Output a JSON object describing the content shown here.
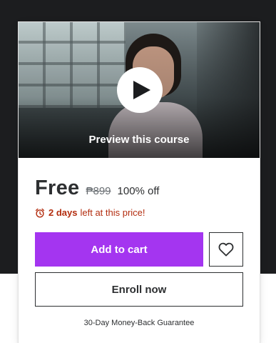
{
  "preview": {
    "label": "Preview this course",
    "play_icon": "play-icon"
  },
  "pricing": {
    "current_price": "Free",
    "original_price": "₱899",
    "discount": "100% off"
  },
  "timer": {
    "icon": "alarm-clock-icon",
    "days": "2 days",
    "suffix": "left at this price!"
  },
  "actions": {
    "add_to_cart_label": "Add to cart",
    "wishlist_icon": "heart-icon",
    "enroll_label": "Enroll now"
  },
  "footer": {
    "guarantee": "30-Day Money-Back Guarantee"
  },
  "colors": {
    "primary_purple": "#a435f0",
    "dark_text": "#2d2f31",
    "muted_text": "#6a6f73",
    "urgency_red": "#b32d0f",
    "page_dark_bg": "#1c1d1f"
  }
}
